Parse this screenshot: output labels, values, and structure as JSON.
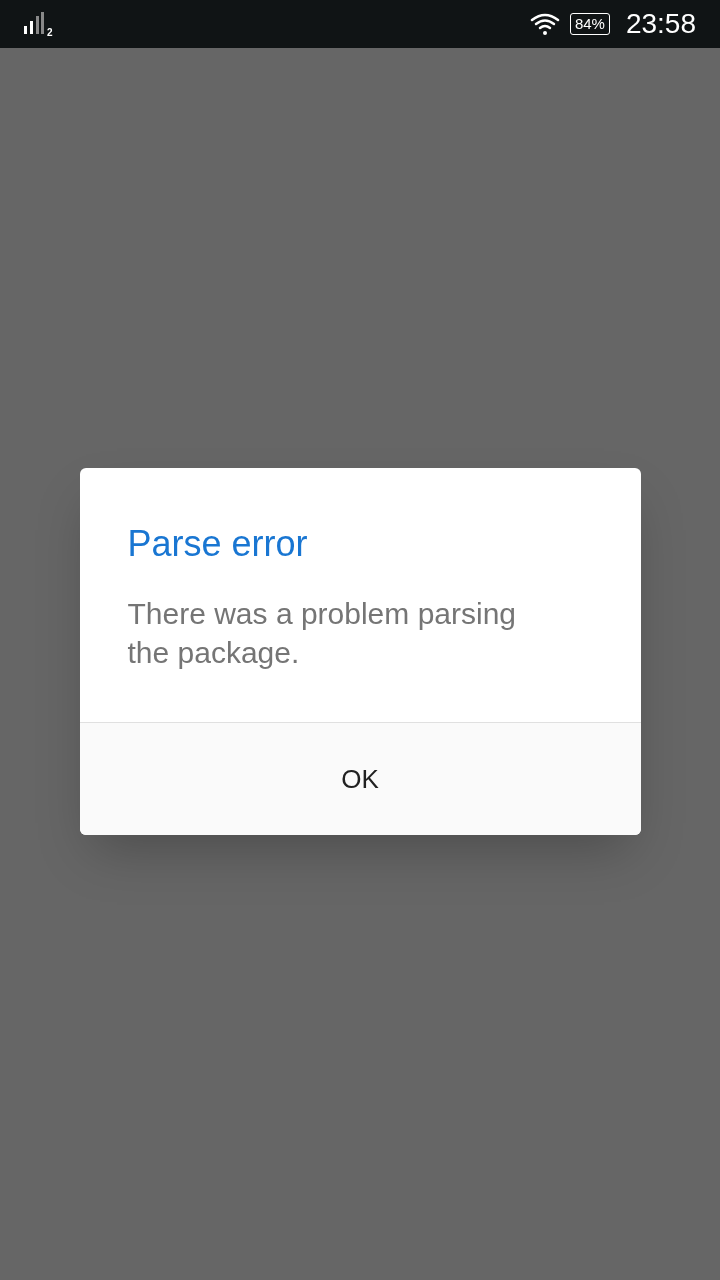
{
  "status_bar": {
    "sim_slot": "2",
    "battery": "84%",
    "time": "23:58"
  },
  "dialog": {
    "title": "Parse error",
    "message": "There was a problem parsing the package.",
    "buttons": [
      "OK"
    ]
  }
}
